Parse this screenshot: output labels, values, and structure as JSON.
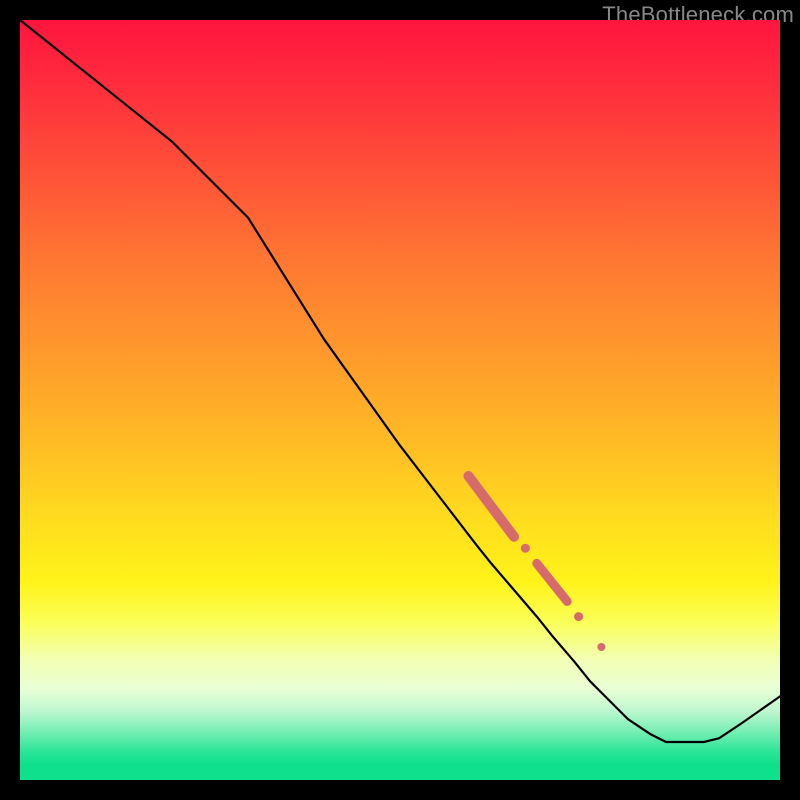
{
  "watermark": "TheBottleneck.com",
  "colors": {
    "line": "#000000",
    "marker_fill": "#d76a6a",
    "marker_stroke": "#c95b5b"
  },
  "chart_data": {
    "type": "line",
    "title": "",
    "xlabel": "",
    "ylabel": "",
    "xlim": [
      0,
      100
    ],
    "ylim": [
      0,
      100
    ],
    "series": [
      {
        "name": "curve",
        "x": [
          0,
          5,
          10,
          15,
          20,
          25,
          30,
          35,
          40,
          45,
          50,
          55,
          60,
          62,
          65,
          68,
          70,
          73,
          75,
          78,
          80,
          83,
          85,
          88,
          90,
          92,
          95,
          100
        ],
        "y": [
          100,
          96,
          92,
          88,
          84,
          79,
          74,
          66,
          58,
          51,
          44,
          37.5,
          31,
          28.5,
          25,
          21.5,
          19,
          15.5,
          13,
          10,
          8,
          6,
          5,
          5,
          5,
          5.5,
          7.5,
          11
        ]
      }
    ],
    "markers": {
      "segments": [
        {
          "x0": 59,
          "y0": 40,
          "x1": 65,
          "y1": 32,
          "width": 10
        },
        {
          "x0": 68,
          "y0": 28.5,
          "x1": 72,
          "y1": 23.5,
          "width": 9
        }
      ],
      "dots": [
        {
          "x": 66.5,
          "y": 30.5,
          "r": 4.5
        },
        {
          "x": 73.5,
          "y": 21.5,
          "r": 4.5
        },
        {
          "x": 76.5,
          "y": 17.5,
          "r": 4
        }
      ]
    }
  }
}
